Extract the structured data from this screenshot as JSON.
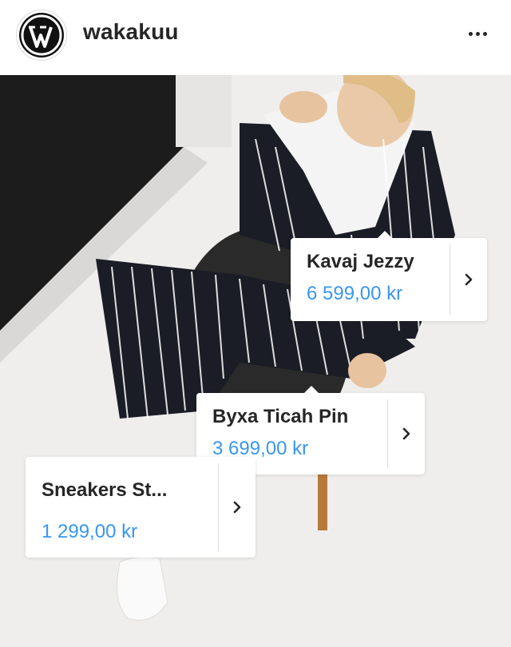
{
  "header": {
    "avatar_icon": "wordpress-logo-icon",
    "username": "wakakuu",
    "more_icon": "more-horizontal-icon"
  },
  "photo": {
    "description_icon": "product-photo"
  },
  "tags": [
    {
      "title": "Kavaj Jezzy",
      "price": "6 599,00 kr",
      "icon": "chevron-right-icon"
    },
    {
      "title": "Byxa Ticah Pin",
      "price": "3 699,00 kr",
      "icon": "chevron-right-icon"
    },
    {
      "title": "Sneakers St...",
      "price": "1 299,00 kr",
      "icon": "chevron-right-icon"
    }
  ],
  "colors": {
    "price_blue": "#3897f0",
    "text_dark": "#262626",
    "divider": "#dbdbdb"
  }
}
